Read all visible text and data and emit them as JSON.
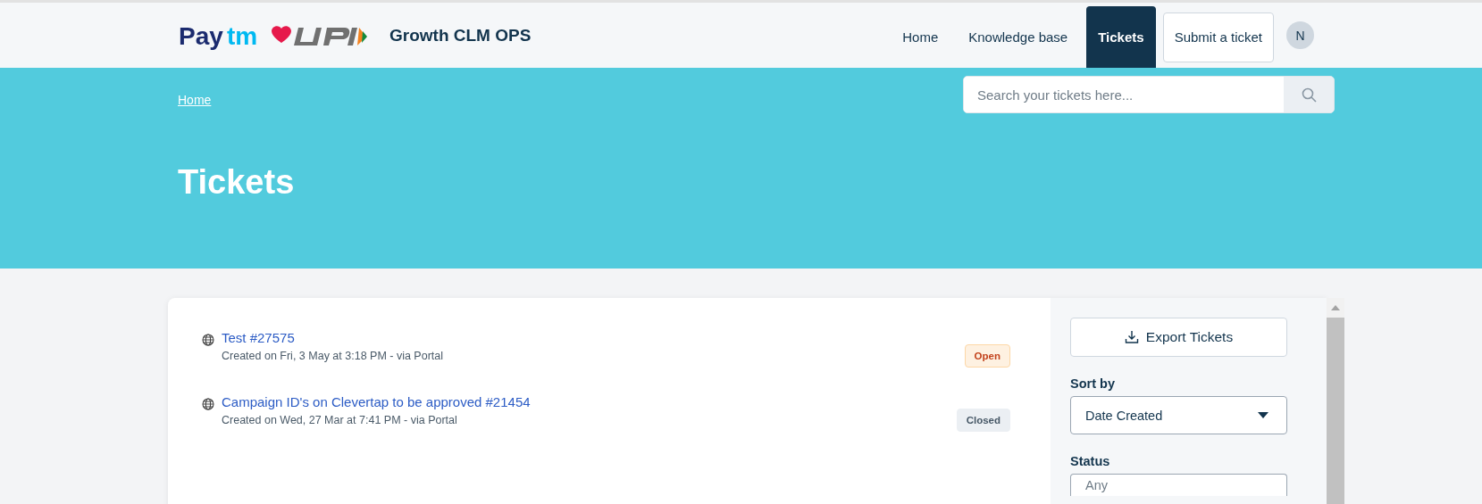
{
  "brand": {
    "logo": [
      "Pay",
      "tm"
    ],
    "title": "Growth CLM OPS"
  },
  "nav": [
    {
      "label": "Home",
      "selected": false,
      "kind": "link"
    },
    {
      "label": "Knowledge base",
      "selected": false,
      "kind": "link"
    },
    {
      "label": "Tickets",
      "selected": true,
      "kind": "link"
    },
    {
      "label": "Submit a ticket",
      "selected": false,
      "kind": "button"
    }
  ],
  "user": {
    "initial": "N"
  },
  "breadcrumb": [
    "Home"
  ],
  "search": {
    "placeholder": "Search your tickets here..."
  },
  "page_title": "Tickets",
  "tickets": [
    {
      "title": "Test #27575",
      "meta": "Created on Fri, 3 May at 3:18 PM - via Portal",
      "status": "Open",
      "kind": "open"
    },
    {
      "title": "Campaign ID's on Clevertap to be approved #21454",
      "meta": "Created on Wed, 27 Mar at 7:41 PM - via Portal",
      "status": "Closed",
      "kind": "closed"
    }
  ],
  "sidebar": {
    "export_label": "Export Tickets",
    "filters": [
      {
        "label": "Sort by",
        "value": "Date Created",
        "kind": "select"
      },
      {
        "label": "Status",
        "value": "Any",
        "kind": "multiselect"
      }
    ]
  }
}
